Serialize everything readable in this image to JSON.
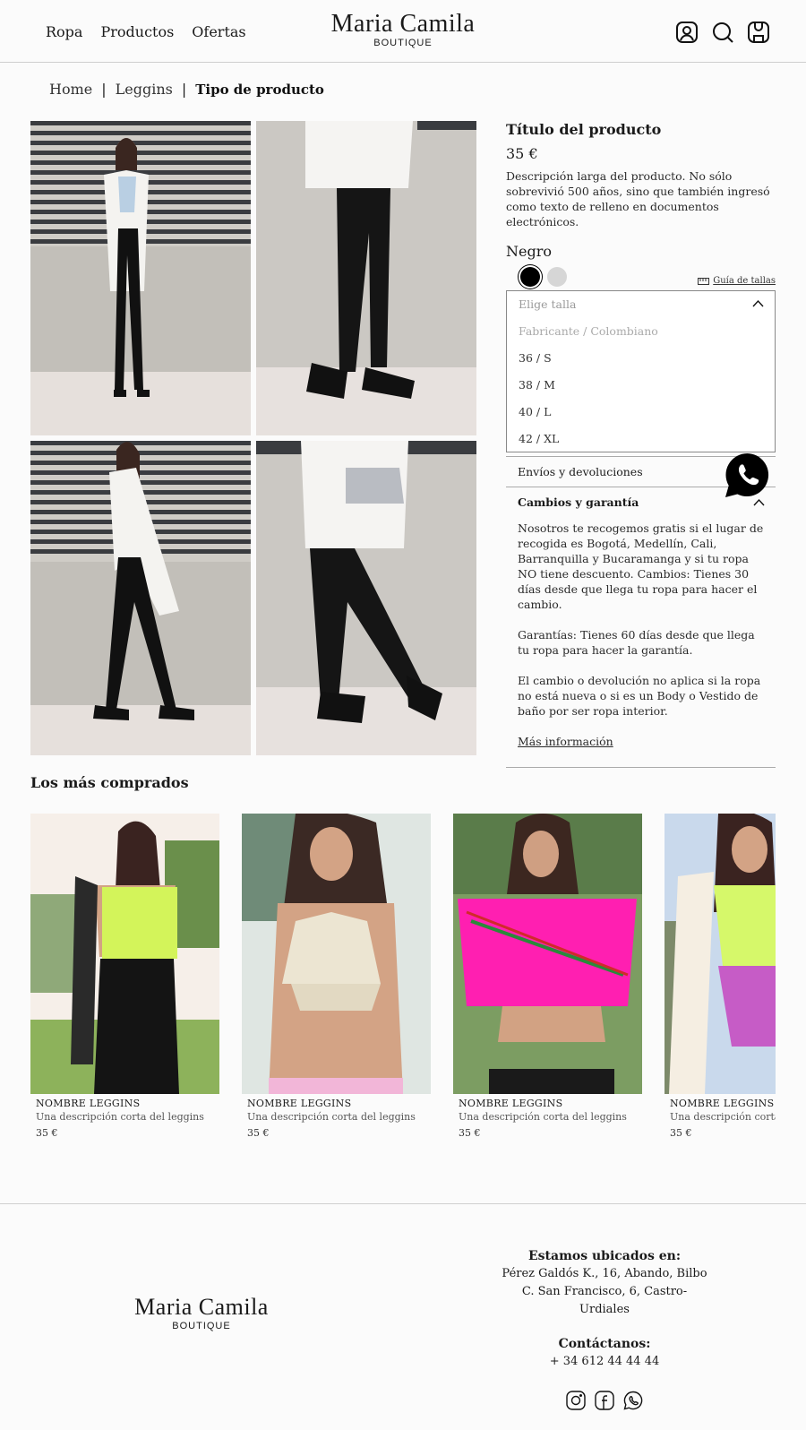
{
  "header": {
    "nav": [
      "Ropa",
      "Productos",
      "Ofertas"
    ],
    "logo_title": "Maria Camila",
    "logo_sub": "BOUTIQUE",
    "icons": [
      "user-icon",
      "search-icon",
      "bag-icon"
    ]
  },
  "breadcrumb": {
    "home": "Home",
    "category": "Leggins",
    "current": "Tipo de producto",
    "separator": "|"
  },
  "product": {
    "title": "Título del producto",
    "price": "35 €",
    "description": "Descripción larga del producto. No sólo sobrevivió 500 años, sino que también ingresó como texto de relleno en documentos electrónicos.",
    "color_label": "Negro",
    "colors": [
      "#000000",
      "#d6d6d6"
    ],
    "size_guide": "Guía de tallas",
    "size_select": {
      "placeholder": "Elige talla",
      "options": [
        "Fabricante / Colombiano",
        "36 / S",
        "38 / M",
        "40 / L",
        "42 / XL"
      ]
    },
    "accordion": {
      "shipping_label": "Envíos y devoluciones",
      "warranty_label": "Cambios y garantía",
      "warranty_p1": "Nosotros te recogemos gratis si el lugar de recogida es Bogotá, Medellín, Cali, Barranquilla y Bucaramanga y si tu ropa NO tiene descuento. Cambios: Tienes 30 días desde que llega tu ropa para hacer el cambio.",
      "warranty_p2": "Garantías: Tienes 60 días desde que llega tu ropa para hacer la garantía.",
      "warranty_p3": "El cambio o devolución no aplica si la ropa no está nueva o si es un Body o Vestido de baño por ser ropa interior.",
      "more_info": "Más información"
    }
  },
  "most_bought": {
    "title": "Los más comprados",
    "items": [
      {
        "name": "NOMBRE LEGGINS",
        "desc": "Una descripción corta del leggins",
        "price": "35 €"
      },
      {
        "name": "NOMBRE LEGGINS",
        "desc": "Una descripción corta del leggins",
        "price": "35 €"
      },
      {
        "name": "NOMBRE LEGGINS",
        "desc": "Una descripción corta del leggins",
        "price": "35 €"
      },
      {
        "name": "NOMBRE LEGGINS",
        "desc": "Una descripción corta del leggins",
        "price": "35 €"
      }
    ]
  },
  "footer": {
    "logo_title": "Maria Camila",
    "logo_sub": "BOUTIQUE",
    "location_head": "Estamos ubicados en:",
    "address1": "Pérez Galdós K., 16, Abando, Bilbo",
    "address2": "C. San Francisco, 6, Castro-Urdiales",
    "contact_head": "Contáctanos:",
    "phone": "+ 34 612 44 44 44",
    "social": [
      "instagram-icon",
      "facebook-icon",
      "whatsapp-icon"
    ]
  }
}
